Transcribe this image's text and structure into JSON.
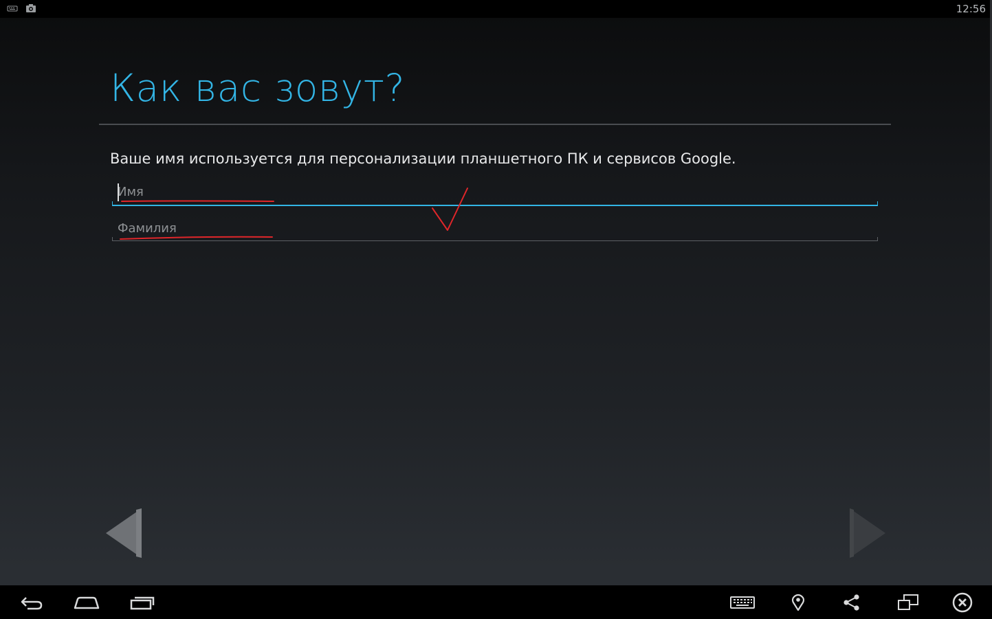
{
  "status_bar": {
    "time": "12:56",
    "notification_icons": [
      "keyboard-icon",
      "screenshot-icon"
    ]
  },
  "setup": {
    "title": "Как вас зовут?",
    "description": "Ваше имя используется для персонализации планшетного ПК и сервисов Google.",
    "first_name": {
      "placeholder": "Имя",
      "value": ""
    },
    "last_name": {
      "placeholder": "Фамилия",
      "value": ""
    }
  },
  "navigation": {
    "prev_icon": "back-arrow-icon",
    "next_icon": "forward-arrow-icon"
  },
  "system_bar": {
    "left_buttons": [
      "back-icon",
      "home-icon",
      "recent-apps-icon"
    ],
    "right_buttons": [
      "keyboard-icon",
      "location-icon",
      "share-icon",
      "rotate-screen-icon",
      "close-icon"
    ]
  },
  "colors": {
    "accent": "#33b5e5",
    "annotation": "#e0262a",
    "text": "#e8e9ea",
    "hint": "#8e9194"
  }
}
